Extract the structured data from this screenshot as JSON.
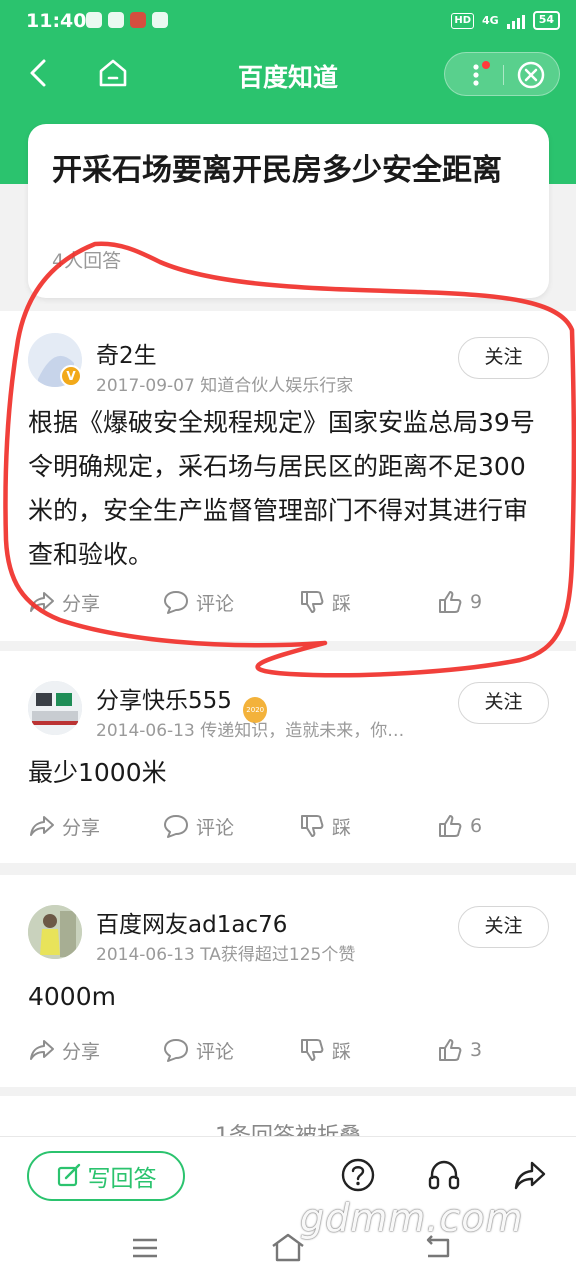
{
  "status_bar": {
    "time": "11:40",
    "network": "4G",
    "battery": "54",
    "hd": "HD"
  },
  "header": {
    "title": "百度知道",
    "back_icon": "back-arrow-icon",
    "home_icon": "home-icon",
    "more_icon": "more-vertical-icon",
    "close_icon": "close-circle-icon"
  },
  "question": {
    "title": "开采石场要离开民房多少安全距离",
    "answer_count": "4人回答"
  },
  "answers": [
    {
      "user": "奇2生",
      "meta": "2017-09-07 知道合伙人娱乐行家",
      "follow": "关注",
      "content": "根据《爆破安全规程规定》国家安监总局39号令明确规定，采石场与居民区的距离不足300米的，安全生产监督管理部门不得对其进行审查和验收。",
      "share": "分享",
      "comment": "评论",
      "dislike": "踩",
      "likes": "9"
    },
    {
      "user": "分享快乐555",
      "meta": "2014-06-13 传递知识，造就未来，你…",
      "follow": "关注",
      "content": "最少1000米",
      "share": "分享",
      "comment": "评论",
      "dislike": "踩",
      "likes": "6",
      "badge_text": "2020"
    },
    {
      "user": "百度网友ad1ac76",
      "meta": "2014-06-13 TA获得超过125个赞",
      "follow": "关注",
      "content": "4000m",
      "share": "分享",
      "comment": "评论",
      "dislike": "踩",
      "likes": "3"
    }
  ],
  "folded": {
    "text": "1条回答被折叠"
  },
  "bottom_bar": {
    "write_answer": "写回答",
    "icons": [
      "help-icon",
      "headphones-icon",
      "share-icon"
    ]
  },
  "watermark": "gdmm.com",
  "colors": {
    "brand_green": "#2bc36e",
    "annotation_red": "#f0302a"
  }
}
